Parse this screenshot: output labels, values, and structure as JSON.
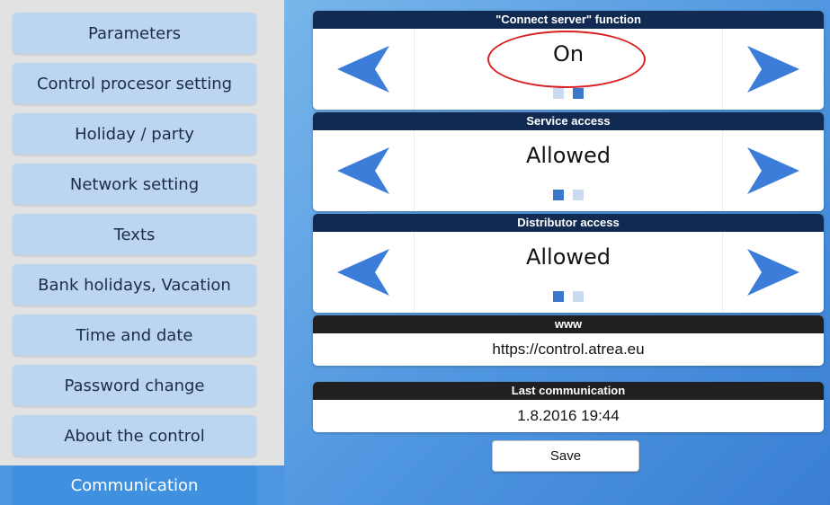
{
  "menu": {
    "items": [
      {
        "label": "Parameters"
      },
      {
        "label": "Control procesor setting"
      },
      {
        "label": "Holiday / party"
      },
      {
        "label": "Network setting"
      },
      {
        "label": "Texts"
      },
      {
        "label": "Bank holidays, Vacation"
      },
      {
        "label": "Time and date"
      },
      {
        "label": "Password change"
      },
      {
        "label": "About the control"
      },
      {
        "label": "Communication",
        "active": true
      }
    ]
  },
  "settings": [
    {
      "title": "\"Connect server\" function",
      "value": "On",
      "selected_index": 1,
      "option_count": 2,
      "highlighted": true
    },
    {
      "title": "Service access",
      "value": "Allowed",
      "selected_index": 0,
      "option_count": 2
    },
    {
      "title": "Distributor access",
      "value": "Allowed",
      "selected_index": 0,
      "option_count": 2
    }
  ],
  "info": {
    "www": {
      "title": "www",
      "value": "https://control.atrea.eu"
    },
    "last_communication": {
      "title": "Last communication",
      "value": "1.8.2016 19:44"
    }
  },
  "save_label": "Save",
  "icons": {
    "previous": "arrow-left-icon",
    "next": "arrow-right-icon"
  },
  "colors": {
    "menu_item": "#bcd5f1",
    "menu_active": "#3f90de",
    "header": "#102a52",
    "info_header": "#202020",
    "arrow": "#3b7dd8",
    "highlight": "#d82020"
  }
}
